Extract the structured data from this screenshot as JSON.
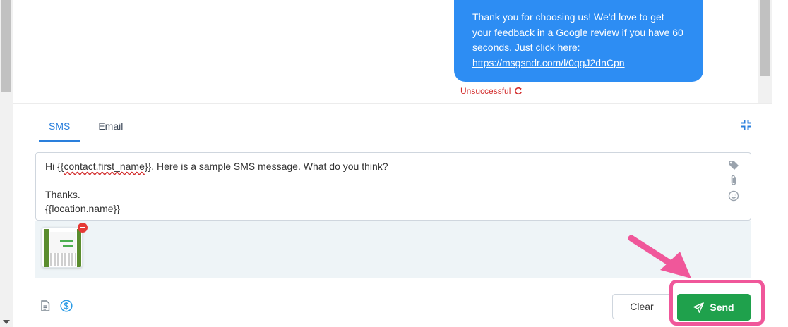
{
  "chat": {
    "message_lines": [
      "Thank you for choosing us! We'd love to get",
      "your feedback in a Google review if you have 60",
      "seconds. Just click here:"
    ],
    "message_link": "https://msgsndr.com/l/0qgJ2dnCpn",
    "status_text": "Unsuccessful"
  },
  "composer": {
    "tabs": [
      {
        "label": "SMS",
        "active": true
      },
      {
        "label": "Email",
        "active": false
      }
    ],
    "editor": {
      "line1_prefix": "Hi {{",
      "line1_var": "contact.first_name",
      "line1_suffix": "}}. Here is a sample SMS message. What do you think?",
      "line2": "",
      "line3": "Thanks.",
      "line4": "{{location.name}}"
    },
    "editor_icons": [
      "tag-icon",
      "paperclip-icon",
      "smiley-icon"
    ],
    "bottom_icons": [
      "document-icon",
      "dollar-icon"
    ],
    "clear_label": "Clear",
    "send_label": "Send"
  },
  "colors": {
    "bubble": "#2d8df3",
    "status_error": "#d32f2f",
    "tab_active": "#2a7fdc",
    "send": "#1fa14c",
    "highlight": "#f0579a"
  }
}
